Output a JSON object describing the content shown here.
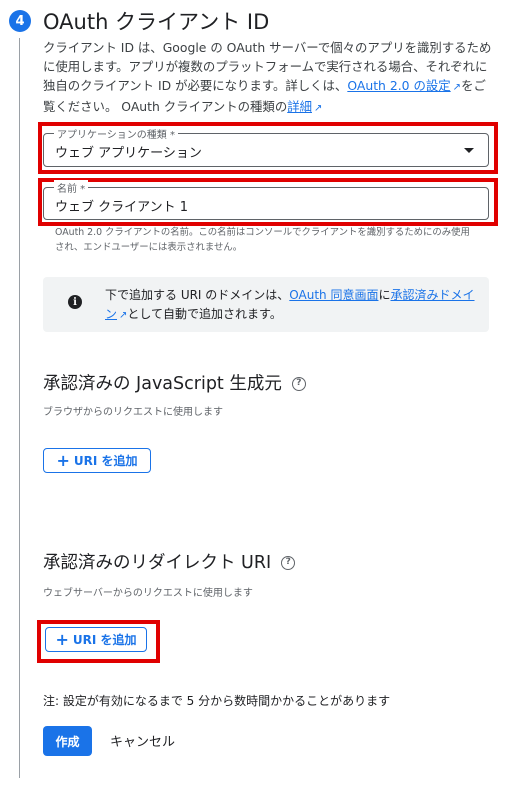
{
  "step": {
    "number": "4",
    "title": "OAuth クライアント ID"
  },
  "intro": {
    "text1": "クライアント ID は、Google の OAuth サーバーで個々のアプリを識別するために使用します。アプリが複数のプラットフォームで実行される場合、それぞれに独自のクライアント ID が必要になります。詳しくは、",
    "link1": "OAuth 2.0 の設定",
    "text2": "をご覧ください。 OAuth クライアントの種類の",
    "link2": "詳細"
  },
  "app_type": {
    "label": "アプリケーションの種類 *",
    "value": "ウェブ アプリケーション"
  },
  "name_field": {
    "label": "名前 *",
    "value": "ウェブ クライアント 1",
    "helper": "OAuth 2.0 クライアントの名前。この名前はコンソールでクライアントを識別するためにのみ使用され、エンドユーザーには表示されません。"
  },
  "info": {
    "text1": "下で追加する URI のドメインは、",
    "link1": "OAuth 同意画面",
    "text2": "に",
    "link2": "承認済みドメイン",
    "text3": "として自動で追加されます。"
  },
  "js_origins": {
    "title": "承認済みの JavaScript 生成元",
    "subtitle": "ブラウザからのリクエストに使用します",
    "add_button": "URI を追加"
  },
  "redirect_uris": {
    "title": "承認済みのリダイレクト URI",
    "subtitle": "ウェブサーバーからのリクエストに使用します",
    "add_button": "URI を追加"
  },
  "note": "注: 設定が有効になるまで 5 分から数時間かかることがあります",
  "actions": {
    "create": "作成",
    "cancel": "キャンセル"
  },
  "icons": {
    "info": "info-icon",
    "help": "help-icon",
    "external": "external-link-icon",
    "dropdown": "dropdown-arrow-icon",
    "add": "plus-icon"
  },
  "colors": {
    "accent": "#1a73e8",
    "highlight": "#e00000",
    "info_bg": "#f1f3f4"
  }
}
